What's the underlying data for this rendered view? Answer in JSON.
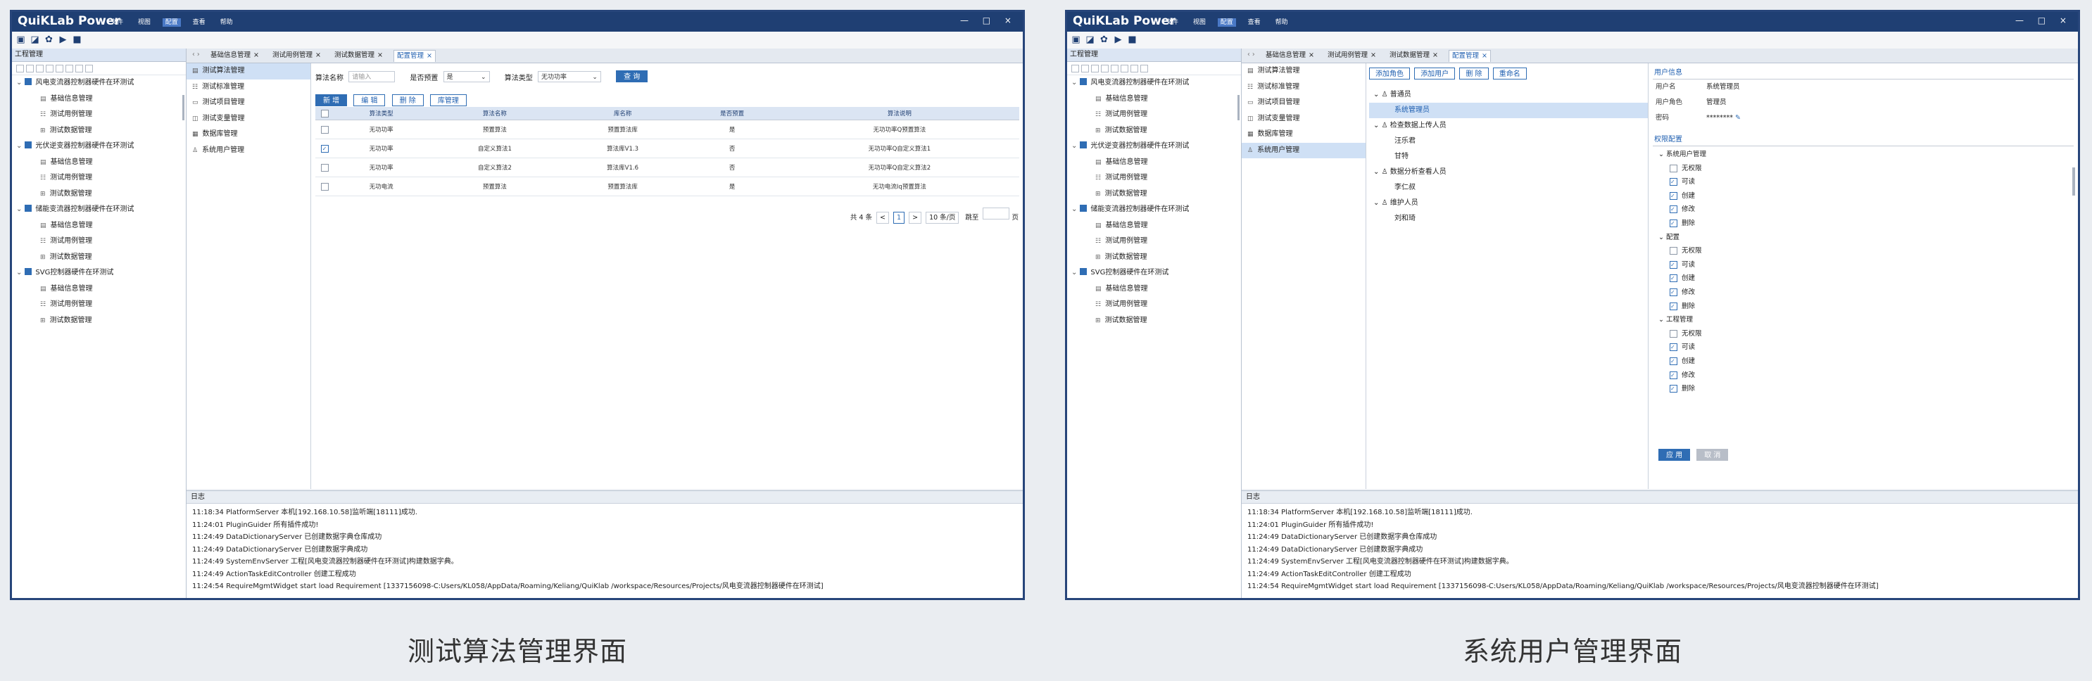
{
  "app": {
    "title": "QuiKLab Power",
    "menu": [
      "文件",
      "视图",
      "配置",
      "查看",
      "帮助"
    ],
    "active_menu_index": 2,
    "window_controls": "— □ ×",
    "toolbar_icons": [
      "save-icon",
      "save-all-icon",
      "settings-icon",
      "run-icon",
      "stop-icon"
    ]
  },
  "panel_title": "工程管理",
  "log_title": "日志",
  "tree": [
    {
      "label": "风电变流器控制器硬件在环测试",
      "children": [
        "基础信息管理",
        "测试用例管理",
        "测试数据管理"
      ]
    },
    {
      "label": "光伏逆变器控制器硬件在环测试",
      "children": [
        "基础信息管理",
        "测试用例管理",
        "测试数据管理"
      ]
    },
    {
      "label": "储能变流器控制器硬件在环测试",
      "children": [
        "基础信息管理",
        "测试用例管理",
        "测试数据管理"
      ]
    },
    {
      "label": "SVG控制器硬件在环测试",
      "children": [
        "基础信息管理",
        "测试用例管理",
        "测试数据管理"
      ]
    }
  ],
  "log_lines": [
    "11:18:34 PlatformServer 本机[192.168.10.58]监听端[18111]成功.",
    "11:24:01 PluginGuider 所有插件成功!",
    "11:24:49 DataDictionaryServer 已创建数据字典仓库成功",
    "11:24:49 DataDictionaryServer 已创建数据字典成功",
    "11:24:49 SystemEnvServer 工程[风电变流器控制器硬件在环测试]构建数据字典。",
    "11:24:49 ActionTaskEditController 创建工程成功",
    "11:24:54 RequireMgmtWidget start load Requirement [1337156098-C:Users/KL058/AppData/Roaming/Keliang/QuiKlab /workspace/Resources/Projects/风电变流器控制器硬件在环测试]"
  ],
  "left_screen": {
    "caption": "测试算法管理界面",
    "tabs": [
      "基础信息管理",
      "测试用例管理",
      "测试数据管理",
      "配置管理"
    ],
    "active_tab": 3,
    "side_menu": [
      "测试算法管理",
      "测试标准管理",
      "测试项目管理",
      "测试变量管理",
      "数据库管理",
      "系统用户管理"
    ],
    "side_icons": [
      "▤",
      "☷",
      "▭",
      "◫",
      "▦",
      "♙"
    ],
    "selected_menu": 0,
    "filter": {
      "name_label": "算法名称",
      "name_placeholder": "请输入",
      "preset_label": "是否预置",
      "preset_value": "是",
      "type_label": "算法类型",
      "type_value": "无功功率",
      "query_button": "查 询"
    },
    "action_buttons": [
      "新 增",
      "编 辑",
      "删 除",
      "库管理"
    ],
    "table": {
      "columns": [
        "算法类型",
        "算法名称",
        "库名称",
        "是否预置",
        "算法说明"
      ],
      "rows": [
        {
          "checked": false,
          "cells": [
            "无功功率",
            "预置算法",
            "预置算法库",
            "是",
            "无功功率Q预置算法"
          ]
        },
        {
          "checked": true,
          "cells": [
            "无功功率",
            "自定义算法1",
            "算法库V1.3",
            "否",
            "无功功率Q自定义算法1"
          ]
        },
        {
          "checked": false,
          "cells": [
            "无功功率",
            "自定义算法2",
            "算法库V1.6",
            "否",
            "无功功率Q自定义算法2"
          ]
        },
        {
          "checked": false,
          "cells": [
            "无功电流",
            "预置算法",
            "预置算法库",
            "是",
            "无功电流Iq预置算法"
          ]
        }
      ]
    },
    "pager": {
      "total": "共 4 条",
      "prev": "<",
      "page": "1",
      "next": ">",
      "per_page": "10 条/页",
      "goto": "跳至",
      "page_unit": "页"
    }
  },
  "right_screen": {
    "caption": "系统用户管理界面",
    "tabs": [
      "基础信息管理",
      "测试用例管理",
      "测试数据管理",
      "配置管理"
    ],
    "active_tab": 3,
    "side_menu": [
      "测试算法管理",
      "测试标准管理",
      "测试项目管理",
      "测试变量管理",
      "数据库管理",
      "系统用户管理"
    ],
    "side_icons": [
      "▤",
      "☷",
      "▭",
      "◫",
      "▦",
      "♙"
    ],
    "selected_menu": 5,
    "buttons": [
      "添加角色",
      "添加用户",
      "删 除",
      "重命名"
    ],
    "roles": [
      {
        "name": "普通员",
        "users": [
          "系统管理员"
        ]
      },
      {
        "name": "检查数据上传人员",
        "users": [
          "汪乐君",
          "甘特"
        ]
      },
      {
        "name": "数据分析查看人员",
        "users": [
          "李仁叔"
        ]
      },
      {
        "name": "维护人员",
        "users": [
          "刘和琦"
        ]
      }
    ],
    "selected_user": "系统管理员",
    "user_info": {
      "title": "用户信息",
      "fields": [
        {
          "key": "用户名",
          "value": "系统管理员"
        },
        {
          "key": "用户角色",
          "value": "管理员"
        },
        {
          "key": "密码",
          "value": "********"
        }
      ]
    },
    "permissions": {
      "title": "权限配置",
      "groups": [
        {
          "name": "系统用户管理",
          "items": [
            {
              "label": "无权限",
              "checked": false
            },
            {
              "label": "可读",
              "checked": true
            },
            {
              "label": "创建",
              "checked": true
            },
            {
              "label": "修改",
              "checked": true
            },
            {
              "label": "删除",
              "checked": true
            }
          ]
        },
        {
          "name": "配置",
          "items": [
            {
              "label": "无权限",
              "checked": false
            },
            {
              "label": "可读",
              "checked": true
            },
            {
              "label": "创建",
              "checked": true
            },
            {
              "label": "修改",
              "checked": true
            },
            {
              "label": "删除",
              "checked": true
            }
          ]
        },
        {
          "name": "工程管理",
          "items": [
            {
              "label": "无权限",
              "checked": false
            },
            {
              "label": "可读",
              "checked": true
            },
            {
              "label": "创建",
              "checked": true
            },
            {
              "label": "修改",
              "checked": true
            },
            {
              "label": "删除",
              "checked": true
            }
          ]
        }
      ]
    },
    "apply_button": "应 用",
    "cancel_button": "取 消"
  }
}
